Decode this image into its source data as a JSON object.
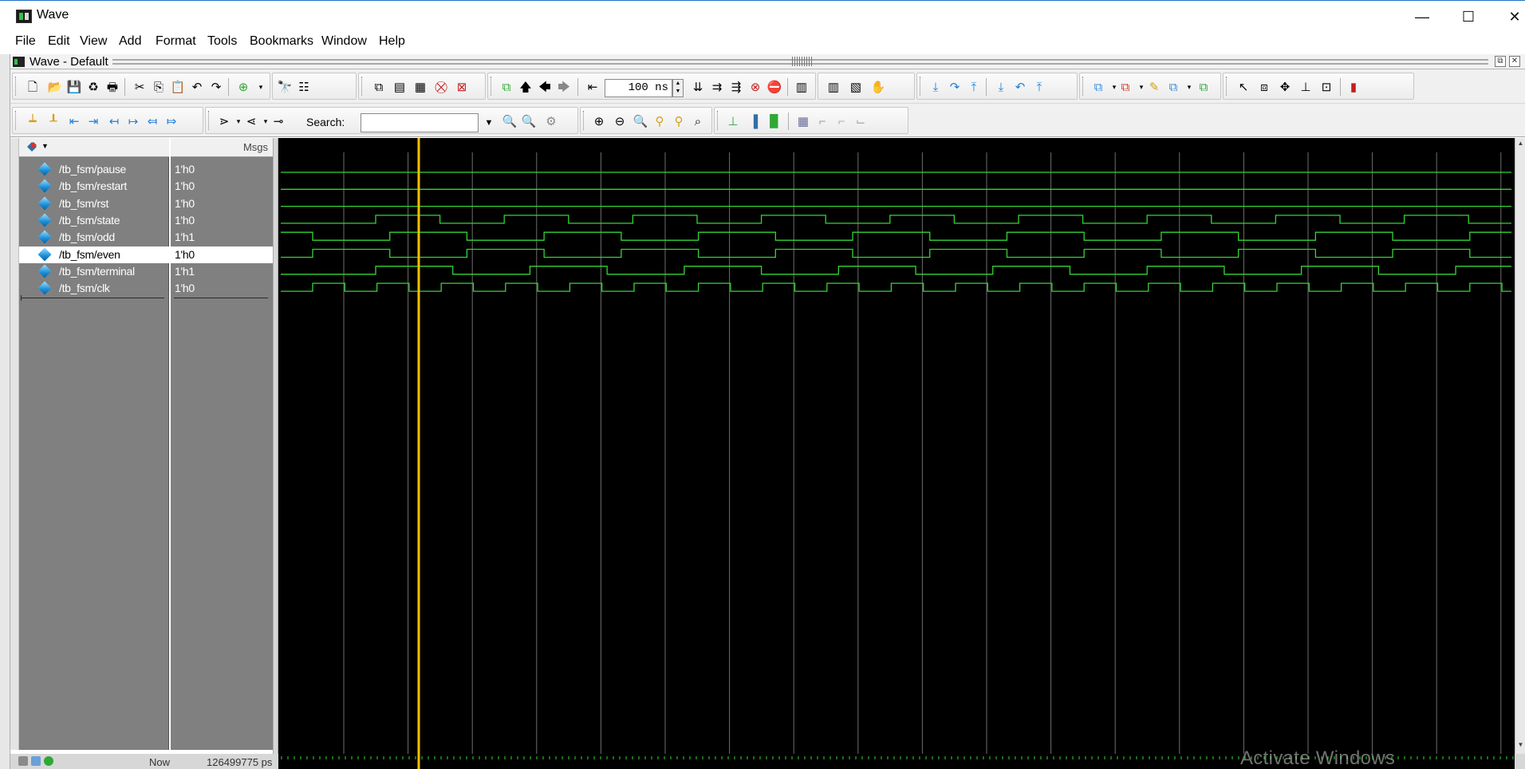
{
  "window": {
    "title": "Wave",
    "controls": {
      "minimize": "—",
      "maximize": "☐",
      "close": "✕"
    }
  },
  "menu": [
    "File",
    "Edit",
    "View",
    "Add",
    "Format",
    "Tools",
    "Bookmarks",
    "Window",
    "Help"
  ],
  "wave_header": {
    "title": "Wave - Default"
  },
  "toolbar": {
    "time_value": "100 ns",
    "search_label": "Search:",
    "search_value": ""
  },
  "panes": {
    "values_header": "Msgs"
  },
  "signals": [
    {
      "name": "/tb_fsm/pause",
      "value": "1'h0",
      "selected": false
    },
    {
      "name": "/tb_fsm/restart",
      "value": "1'h0",
      "selected": false
    },
    {
      "name": "/tb_fsm/rst",
      "value": "1'h0",
      "selected": false
    },
    {
      "name": "/tb_fsm/state",
      "value": "1'h0",
      "selected": false
    },
    {
      "name": "/tb_fsm/odd",
      "value": "1'h1",
      "selected": false
    },
    {
      "name": "/tb_fsm/even",
      "value": "1'h0",
      "selected": true
    },
    {
      "name": "/tb_fsm/terminal",
      "value": "1'h1",
      "selected": false
    },
    {
      "name": "/tb_fsm/clk",
      "value": "1'h0",
      "selected": false
    }
  ],
  "status": {
    "now_label": "Now",
    "now_value": "126499775 ps"
  },
  "colors": {
    "wave": "#33d633",
    "cursor": "#ffc000",
    "grid": "#6e6e6e",
    "selected_row": "#ffffff"
  },
  "watermark": "Activate Windows"
}
